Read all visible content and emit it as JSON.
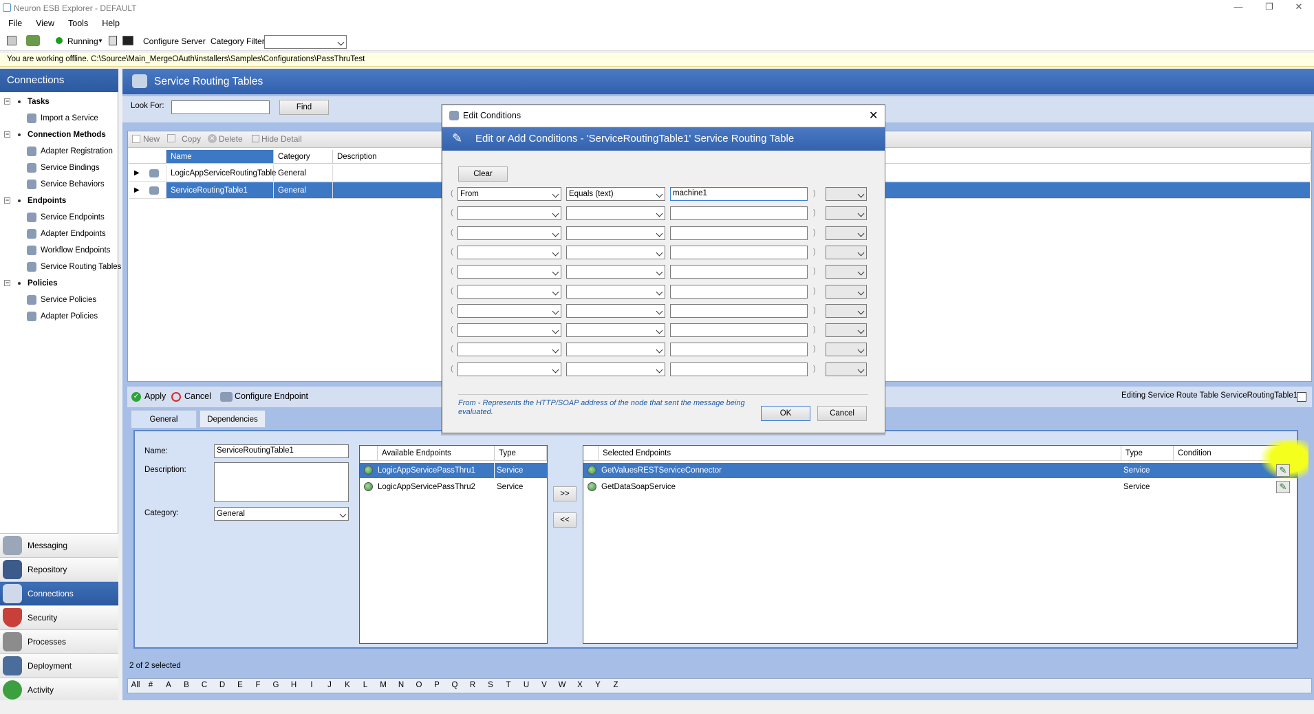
{
  "window": {
    "title": "Neuron ESB Explorer - DEFAULT",
    "minimize": "—",
    "restore": "❐",
    "close": "✕"
  },
  "menu": [
    "File",
    "View",
    "Tools",
    "Help"
  ],
  "toolbar": {
    "status": "Running",
    "configure_server": "Configure Server",
    "category_filter_label": "Category Filter",
    "category_filter_value": ""
  },
  "offline_message": "You are working offline. C:\\Source\\Main_MergeOAuth\\installers\\Samples\\Configurations\\PassThruTest",
  "left_panel": {
    "header": "Connections",
    "tree": [
      {
        "label": "Tasks",
        "group": true
      },
      {
        "label": "Import a Service",
        "group": false
      },
      {
        "label": "Connection Methods",
        "group": true
      },
      {
        "label": "Adapter Registration",
        "group": false
      },
      {
        "label": "Service Bindings",
        "group": false
      },
      {
        "label": "Service Behaviors",
        "group": false
      },
      {
        "label": "Endpoints",
        "group": true
      },
      {
        "label": "Service Endpoints",
        "group": false
      },
      {
        "label": "Adapter Endpoints",
        "group": false
      },
      {
        "label": "Workflow Endpoints",
        "group": false
      },
      {
        "label": "Service Routing Tables",
        "group": false
      },
      {
        "label": "Policies",
        "group": true
      },
      {
        "label": "Service Policies",
        "group": false
      },
      {
        "label": "Adapter Policies",
        "group": false
      }
    ],
    "nav": [
      "Messaging",
      "Repository",
      "Connections",
      "Security",
      "Processes",
      "Deployment",
      "Activity"
    ],
    "nav_selected": "Connections"
  },
  "main": {
    "title": "Service Routing Tables",
    "look_for_label": "Look For:",
    "look_for_value": "",
    "find": "Find",
    "grid_toolbar": {
      "new": "New",
      "copy": "Copy",
      "delete": "Delete",
      "hide_detail": "Hide Detail"
    },
    "columns": [
      "Name",
      "Category",
      "Description"
    ],
    "rows": [
      {
        "name": "LogicAppServiceRoutingTable",
        "category": "General",
        "description": ""
      },
      {
        "name": "ServiceRoutingTable1",
        "category": "General",
        "description": ""
      }
    ],
    "detail": {
      "apply": "Apply",
      "cancel": "Cancel",
      "configure_endpoint": "Configure Endpoint",
      "editing_text": "Editing Service Route Table ServiceRoutingTable1",
      "tabs": [
        "General",
        "Dependencies"
      ],
      "name_label": "Name:",
      "name_value": "ServiceRoutingTable1",
      "description_label": "Description:",
      "description_value": "",
      "category_label": "Category:",
      "category_value": "General",
      "available_header": [
        "Available Endpoints",
        "Type"
      ],
      "available": [
        {
          "name": "LogicAppServicePassThru1",
          "type": "Service"
        },
        {
          "name": "LogicAppServicePassThru2",
          "type": "Service"
        }
      ],
      "add": ">>",
      "remove": "<<",
      "selected_header": [
        "Selected Endpoints",
        "Type",
        "Condition"
      ],
      "selected": [
        {
          "name": "GetValuesRESTServiceConnector",
          "type": "Service",
          "condition": ""
        },
        {
          "name": "GetDataSoapService",
          "type": "Service",
          "condition": ""
        }
      ]
    },
    "status": "2 of 2 selected",
    "alphabet": [
      "All",
      "#",
      "A",
      "B",
      "C",
      "D",
      "E",
      "F",
      "G",
      "H",
      "I",
      "J",
      "K",
      "L",
      "M",
      "N",
      "O",
      "P",
      "Q",
      "R",
      "S",
      "T",
      "U",
      "V",
      "W",
      "X",
      "Y",
      "Z"
    ]
  },
  "dialog": {
    "title": "Edit Conditions",
    "banner": "Edit or Add Conditions - 'ServiceRoutingTable1' Service Routing Table",
    "clear": "Clear",
    "conditions": [
      {
        "field": "From",
        "operator": "Equals (text)",
        "value": "machine1",
        "join": ""
      },
      {
        "field": "",
        "operator": "",
        "value": "",
        "join": ""
      },
      {
        "field": "",
        "operator": "",
        "value": "",
        "join": ""
      },
      {
        "field": "",
        "operator": "",
        "value": "",
        "join": ""
      },
      {
        "field": "",
        "operator": "",
        "value": "",
        "join": ""
      },
      {
        "field": "",
        "operator": "",
        "value": "",
        "join": ""
      },
      {
        "field": "",
        "operator": "",
        "value": "",
        "join": ""
      },
      {
        "field": "",
        "operator": "",
        "value": "",
        "join": ""
      },
      {
        "field": "",
        "operator": "",
        "value": "",
        "join": ""
      },
      {
        "field": "",
        "operator": "",
        "value": "",
        "join": ""
      }
    ],
    "open_paren": "(",
    "close_paren": ")",
    "help_text": "From - Represents the HTTP/SOAP address of the node that sent the message being evaluated.",
    "ok": "OK",
    "cancel": "Cancel"
  }
}
